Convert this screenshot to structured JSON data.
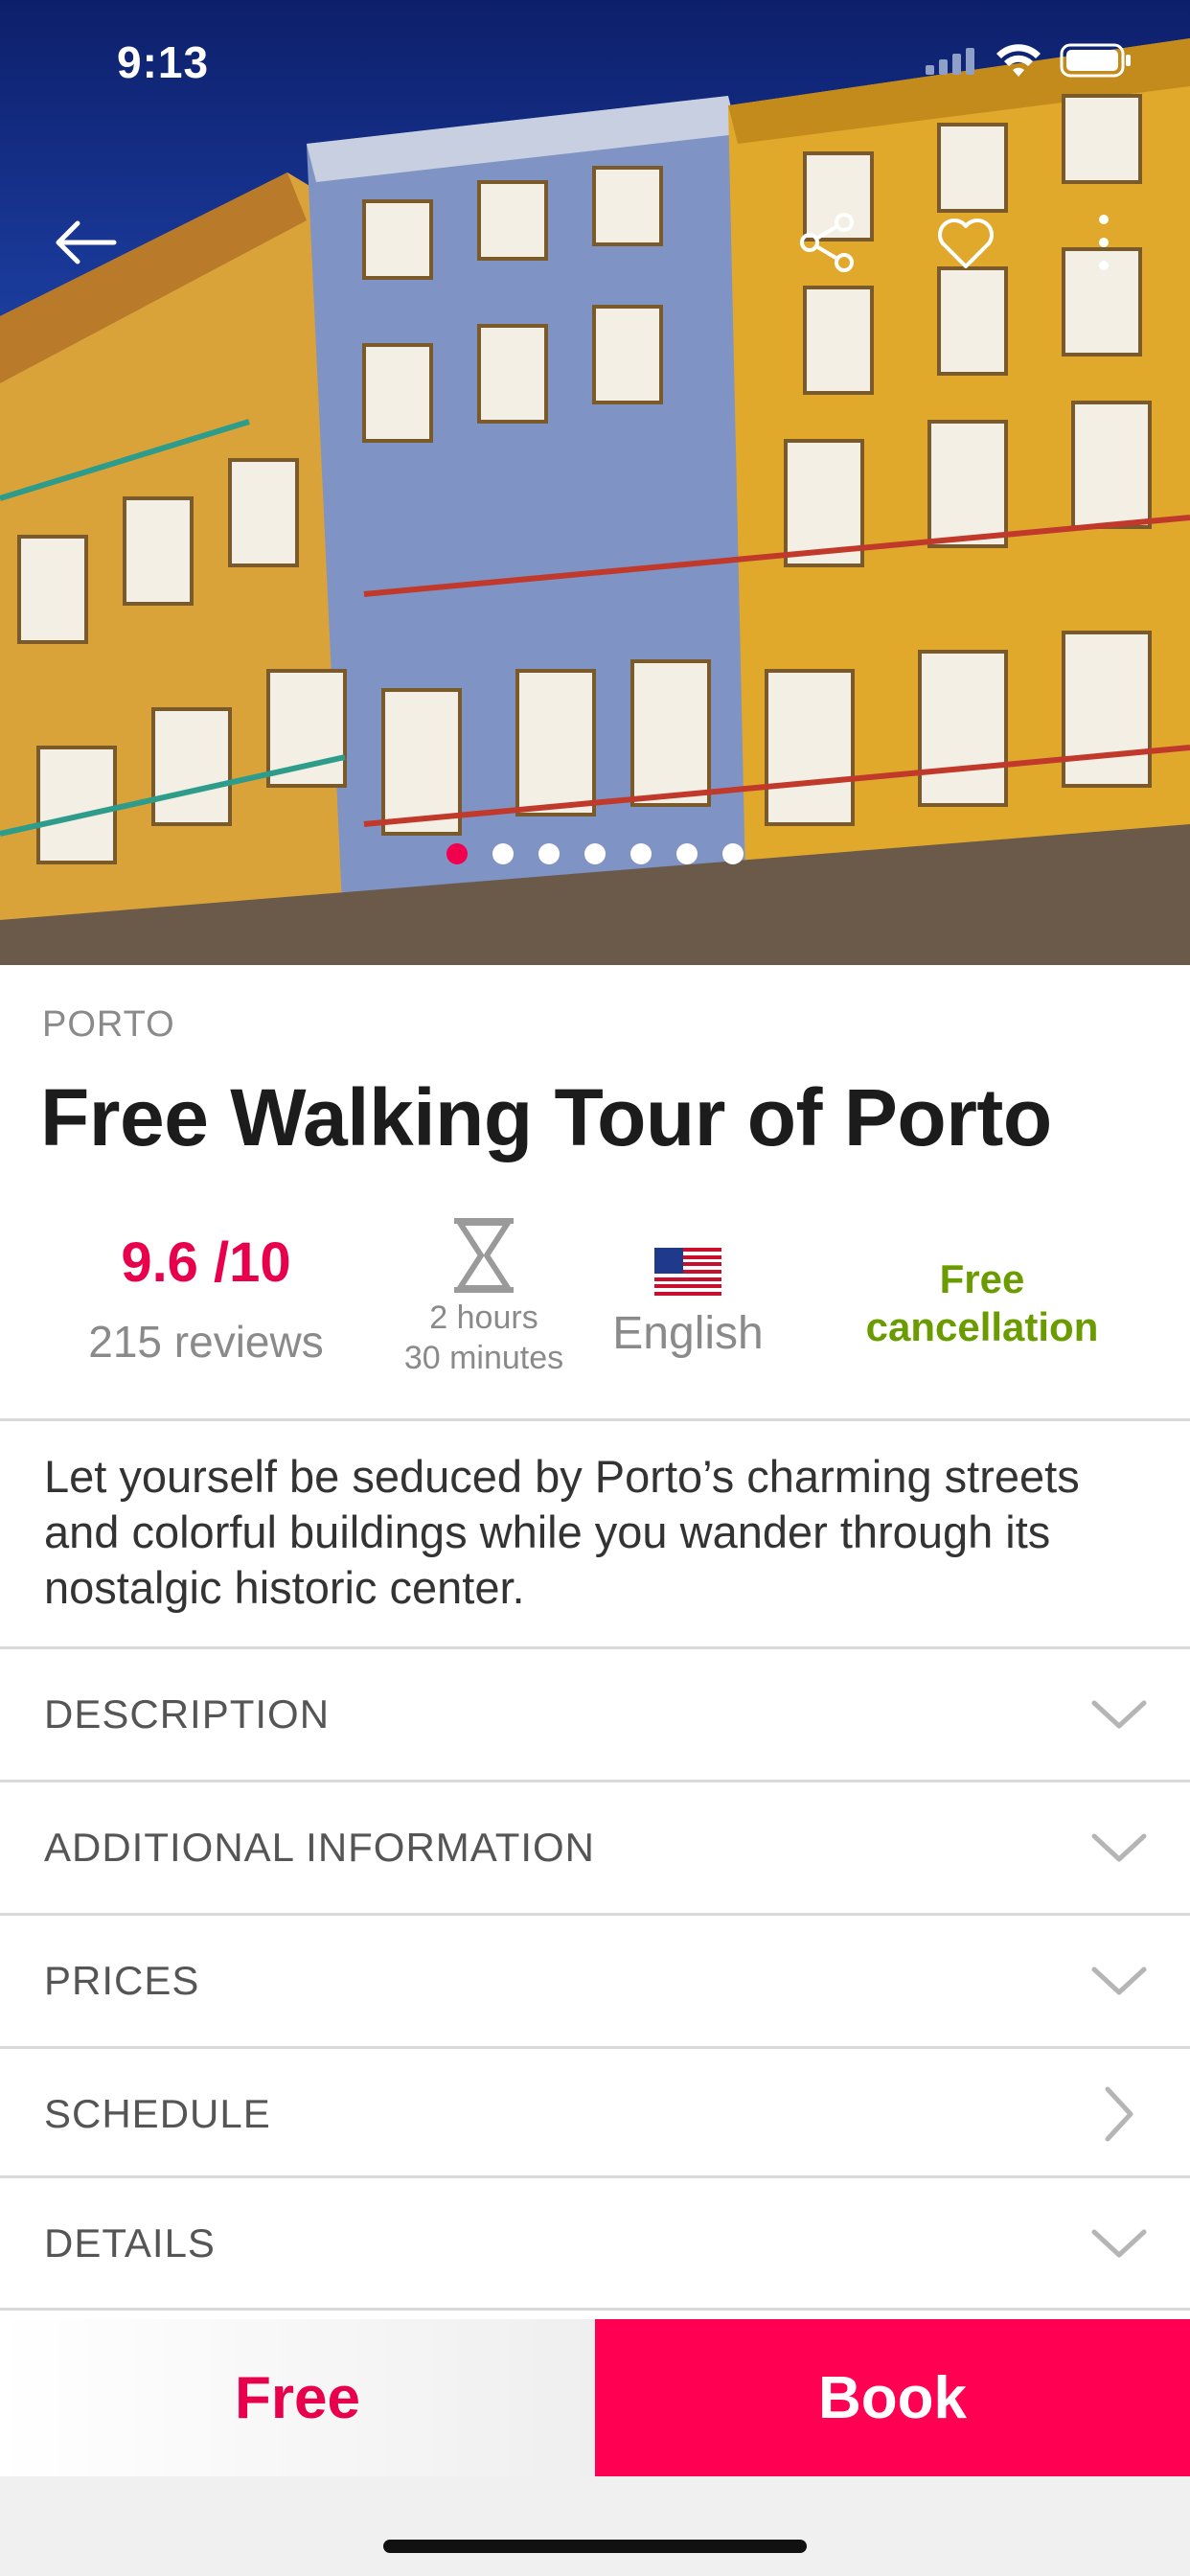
{
  "status_bar": {
    "time": "9:13"
  },
  "hero": {
    "carousel": {
      "total": 7,
      "active_index": 0
    },
    "icons": {
      "back": "arrow-left-icon",
      "share": "share-icon",
      "favorite": "heart-icon",
      "more": "more-vertical-icon"
    },
    "colors": {
      "active_dot": "#f0004e"
    }
  },
  "tour": {
    "city": "PORTO",
    "title": "Free Walking Tour of Porto",
    "rating": {
      "score": "9.6 /10",
      "reviews": "215 reviews"
    },
    "duration": {
      "line1": "2 hours",
      "line2": "30 minutes",
      "icon": "hourglass-icon"
    },
    "language": {
      "label": "English",
      "icon": "us-flag-icon"
    },
    "cancellation": {
      "line1": "Free",
      "line2": "cancellation"
    },
    "summary": "Let yourself be seduced by Porto’s charming streets and colorful buildings while you wander through its nostalgic historic center."
  },
  "sections": [
    {
      "label": "DESCRIPTION",
      "icon": "chevron-down-icon"
    },
    {
      "label": "ADDITIONAL INFORMATION",
      "icon": "chevron-down-icon"
    },
    {
      "label": "PRICES",
      "icon": "chevron-down-icon"
    },
    {
      "label": "SCHEDULE",
      "icon": "chevron-right-icon"
    },
    {
      "label": "DETAILS",
      "icon": "chevron-down-icon"
    }
  ],
  "bottom_bar": {
    "price_label": "Free",
    "book_label": "Book",
    "colors": {
      "accent": "#ff0052",
      "success": "#6a9c00"
    }
  }
}
